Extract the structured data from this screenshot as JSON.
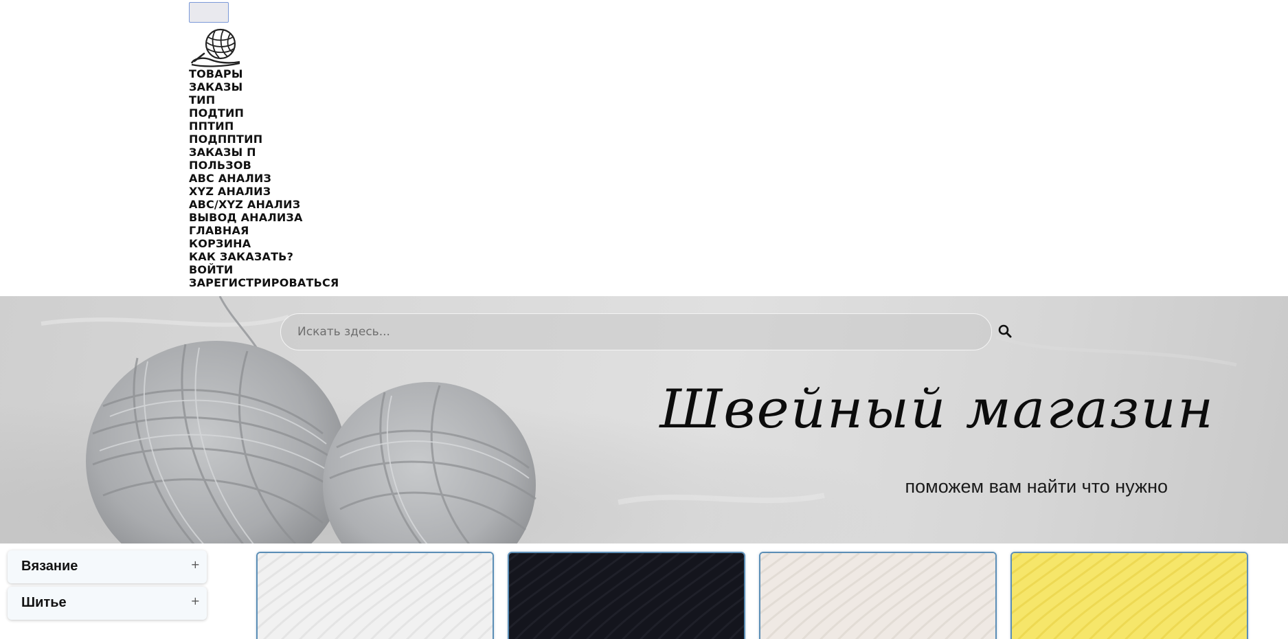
{
  "nav": {
    "items": [
      {
        "label": "ТОВАРЫ",
        "name": "nav-item-tovary"
      },
      {
        "label": "ЗАКАЗЫ",
        "name": "nav-item-zakazy"
      },
      {
        "label": "ТИП",
        "name": "nav-item-tip"
      },
      {
        "label": "ПОДТИП",
        "name": "nav-item-podtip"
      },
      {
        "label": "ППТИП",
        "name": "nav-item-pptip"
      },
      {
        "label": "ПОДППТИП",
        "name": "nav-item-podpptip"
      },
      {
        "label": "ЗАКАЗЫ П",
        "name": "nav-item-zakazy-p"
      },
      {
        "label": "ПОЛЬЗОВ",
        "name": "nav-item-polzov"
      },
      {
        "label": "ABC АНАЛИЗ",
        "name": "nav-item-abc-analysis"
      },
      {
        "label": "XYZ АНАЛИЗ",
        "name": "nav-item-xyz-analysis"
      },
      {
        "label": "ABC/XYZ АНАЛИЗ",
        "name": "nav-item-abc-xyz-analysis"
      },
      {
        "label": "ВЫВОД АНАЛИЗА",
        "name": "nav-item-analysis-output"
      },
      {
        "label": "ГЛАВНАЯ",
        "name": "nav-item-home"
      },
      {
        "label": "КОРЗИНА",
        "name": "nav-item-cart"
      },
      {
        "label": "КАК ЗАКАЗАТЬ?",
        "name": "nav-item-how-to-order"
      },
      {
        "label": "ВОЙТИ",
        "name": "nav-item-login"
      },
      {
        "label": "ЗАРЕГИСТРИРОВАТЬСЯ",
        "name": "nav-item-register"
      }
    ]
  },
  "search": {
    "placeholder": "Искать здесь...",
    "value": ""
  },
  "hero": {
    "title": "Швейный магазин",
    "subtitle": "поможем вам найти что нужно"
  },
  "categories": [
    {
      "label": "Вязание",
      "toggle": "+"
    },
    {
      "label": "Шитье",
      "toggle": "+"
    }
  ],
  "products": [
    {
      "color": "#f1f1f1",
      "thread": "#dedede"
    },
    {
      "color": "#14151d",
      "thread": "#24252f"
    },
    {
      "color": "#efe9e4",
      "thread": "#ddd5cf"
    },
    {
      "color": "#f6e66a",
      "thread": "#e9d34a"
    }
  ],
  "icons": {
    "logo": "yarn-ball-logo-icon",
    "search": "search-icon"
  }
}
